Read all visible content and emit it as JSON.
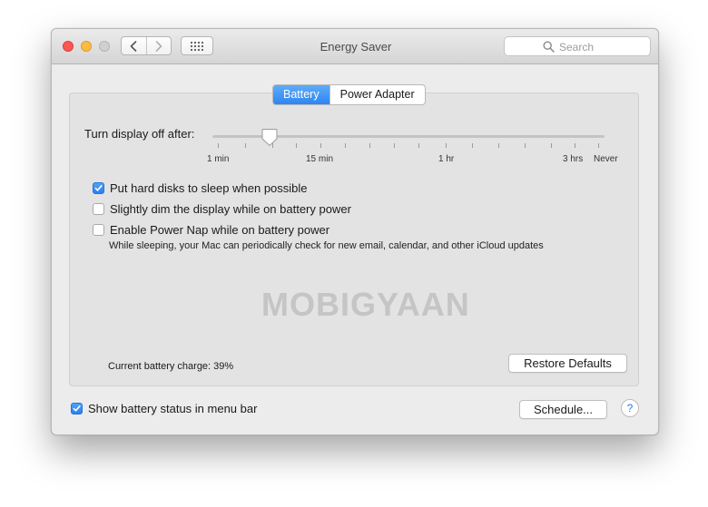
{
  "window": {
    "title": "Energy Saver",
    "search_placeholder": "Search"
  },
  "tabs": [
    {
      "label": "Battery",
      "active": true
    },
    {
      "label": "Power Adapter",
      "active": false
    }
  ],
  "slider": {
    "label": "Turn display off after:",
    "tick_labels": [
      "1 min",
      "15 min",
      "1 hr",
      "3 hrs",
      "Never"
    ],
    "value": 0.14
  },
  "options": [
    {
      "label": "Put hard disks to sleep when possible",
      "checked": true
    },
    {
      "label": "Slightly dim the display while on battery power",
      "checked": false
    },
    {
      "label": "Enable Power Nap while on battery power",
      "checked": false
    }
  ],
  "power_nap_description": "While sleeping, your Mac can periodically check for new email, calendar, and other iCloud updates",
  "watermark": "MOBIGYAAN",
  "battery_charge": "Current battery charge: 39%",
  "restore_label": "Restore Defaults",
  "menu_bar_option": {
    "label": "Show battery status in menu bar",
    "checked": true
  },
  "schedule_label": "Schedule...",
  "help_label": "?",
  "colors": {
    "accent": "#2e86f0",
    "close": "#fc5753",
    "minimize": "#fdbc40"
  }
}
